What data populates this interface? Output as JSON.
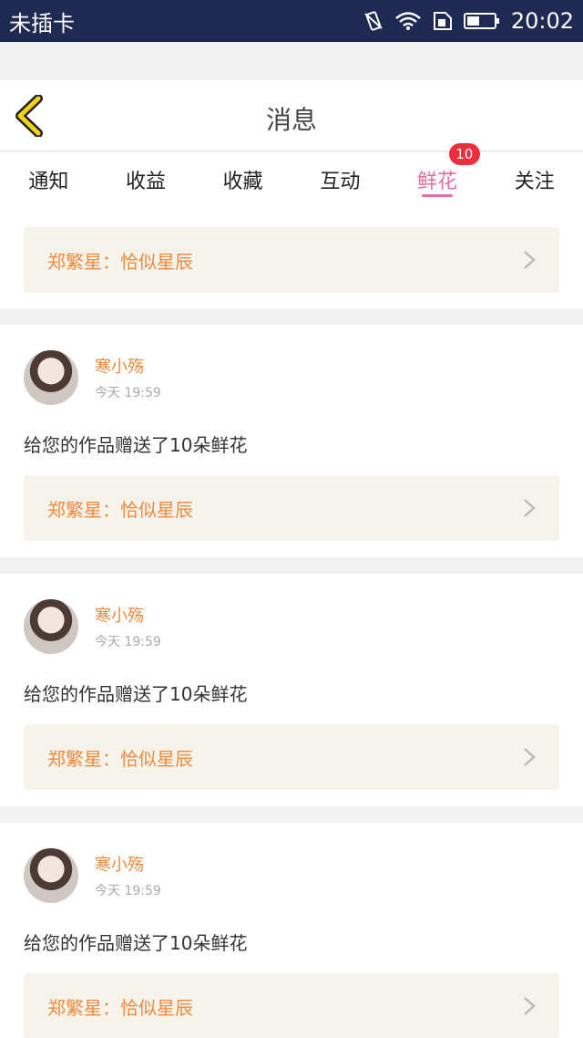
{
  "status": {
    "carrier": "未插卡",
    "time": "20:02"
  },
  "header": {
    "title": "消息"
  },
  "tabs": [
    {
      "label": "通知",
      "active": false
    },
    {
      "label": "收益",
      "active": false
    },
    {
      "label": "收藏",
      "active": false
    },
    {
      "label": "互动",
      "active": false
    },
    {
      "label": "鲜花",
      "active": true,
      "badge": "10"
    },
    {
      "label": "关注",
      "active": false
    }
  ],
  "partial_card": {
    "work": "郑繁星：恰似星辰"
  },
  "cards": [
    {
      "username": "寒小殇",
      "time": "今天 19:59",
      "message": "给您的作品赠送了10朵鲜花",
      "work": "郑繁星：恰似星辰"
    },
    {
      "username": "寒小殇",
      "time": "今天 19:59",
      "message": "给您的作品赠送了10朵鲜花",
      "work": "郑繁星：恰似星辰"
    },
    {
      "username": "寒小殇",
      "time": "今天 19:59",
      "message": "给您的作品赠送了10朵鲜花",
      "work": "郑繁星：恰似星辰"
    }
  ],
  "colors": {
    "accent": "#e96ba6",
    "username": "#f08a3e",
    "badge": "#ee2d3d",
    "statusbar": "#1f2a52"
  }
}
